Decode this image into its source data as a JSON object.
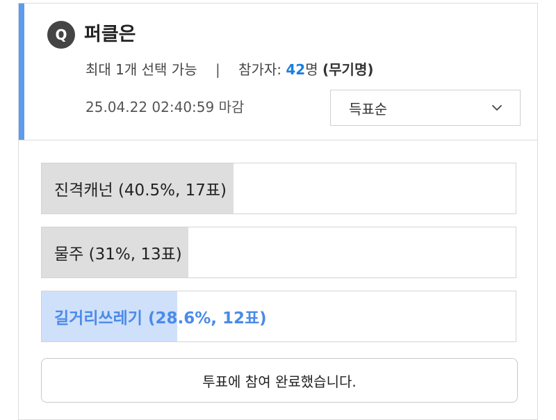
{
  "poll": {
    "badge": "Q",
    "title": "퍼클은",
    "limit_text": "최대 1개 선택 가능",
    "separator": "|",
    "participants_label": "참가자:",
    "participants_count": "42",
    "participants_unit": "명",
    "anonymous": "(무기명)",
    "deadline": "25.04.22 02:40:59 마감",
    "sort_label": "득표순",
    "sort_icon": "chevron-down-icon",
    "accent_color": "#5e9bef",
    "options": [
      {
        "label": "진격캐넌 (40.5%, 17표)",
        "percent": 40.5,
        "votes": 17,
        "selected": false
      },
      {
        "label": "물주 (31%, 13표)",
        "percent": 31,
        "votes": 13,
        "selected": false
      },
      {
        "label": "길거리쓰레기 (28.6%, 12표)",
        "percent": 28.6,
        "votes": 12,
        "selected": true
      }
    ],
    "done_label": "투표에 참여 완료했습니다."
  }
}
